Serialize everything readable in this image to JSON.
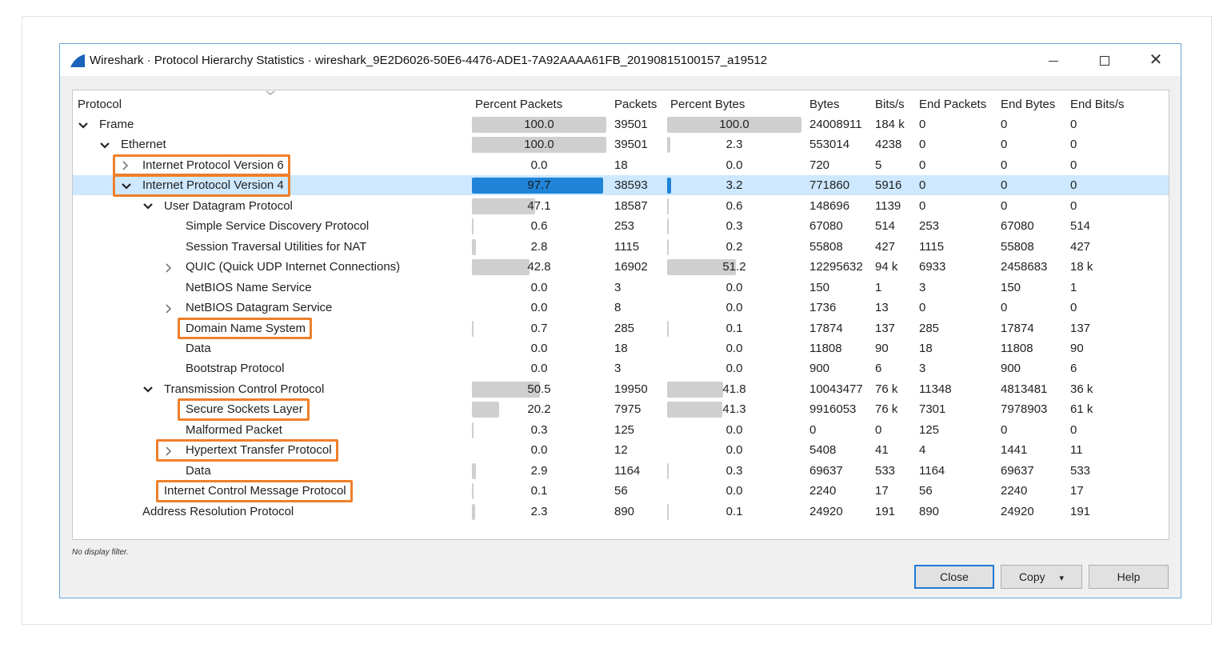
{
  "window": {
    "title": "Wireshark · Protocol Hierarchy Statistics · wireshark_9E2D6026-50E6-4476-ADE1-7A92AAAA61FB_20190815100157_a19512",
    "minimize_icon": "minimize-icon",
    "maximize_icon": "maximize-icon",
    "close_glyph": "✕"
  },
  "columns": [
    "Protocol",
    "Percent Packets",
    "Packets",
    "Percent Bytes",
    "Bytes",
    "Bits/s",
    "End Packets",
    "End Bytes",
    "End Bits/s"
  ],
  "rows": [
    {
      "name": "Frame",
      "level": 0,
      "expand": "open",
      "pct_packets": "100.0",
      "pct_packets_v": 100.0,
      "packets": "39501",
      "pct_bytes": "100.0",
      "pct_bytes_v": 100.0,
      "bytes": "24008911",
      "bits": "184 k",
      "end_packets": "0",
      "end_bytes": "0",
      "end_bits": "0"
    },
    {
      "name": "Ethernet",
      "level": 1,
      "expand": "open",
      "pct_packets": "100.0",
      "pct_packets_v": 100.0,
      "packets": "39501",
      "pct_bytes": "2.3",
      "pct_bytes_v": 2.3,
      "bytes": "553014",
      "bits": "4238",
      "end_packets": "0",
      "end_bytes": "0",
      "end_bits": "0"
    },
    {
      "name": "Internet Protocol Version 6",
      "level": 2,
      "expand": "closed",
      "pct_packets": "0.0",
      "pct_packets_v": 0.0,
      "packets": "18",
      "pct_bytes": "0.0",
      "pct_bytes_v": 0.0,
      "bytes": "720",
      "bits": "5",
      "end_packets": "0",
      "end_bytes": "0",
      "end_bits": "0"
    },
    {
      "name": "Internet Protocol Version 4",
      "level": 2,
      "expand": "open",
      "selected": true,
      "pct_packets": "97.7",
      "pct_packets_v": 97.7,
      "packets": "38593",
      "pct_bytes": "3.2",
      "pct_bytes_v": 3.2,
      "bytes": "771860",
      "bits": "5916",
      "end_packets": "0",
      "end_bytes": "0",
      "end_bits": "0"
    },
    {
      "name": "User Datagram Protocol",
      "level": 3,
      "expand": "open",
      "pct_packets": "47.1",
      "pct_packets_v": 47.1,
      "packets": "18587",
      "pct_bytes": "0.6",
      "pct_bytes_v": 0.6,
      "bytes": "148696",
      "bits": "1139",
      "end_packets": "0",
      "end_bytes": "0",
      "end_bits": "0"
    },
    {
      "name": "Simple Service Discovery Protocol",
      "level": 4,
      "expand": "none",
      "pct_packets": "0.6",
      "pct_packets_v": 0.6,
      "packets": "253",
      "pct_bytes": "0.3",
      "pct_bytes_v": 0.3,
      "bytes": "67080",
      "bits": "514",
      "end_packets": "253",
      "end_bytes": "67080",
      "end_bits": "514"
    },
    {
      "name": "Session Traversal Utilities for NAT",
      "level": 4,
      "expand": "none",
      "pct_packets": "2.8",
      "pct_packets_v": 2.8,
      "packets": "1115",
      "pct_bytes": "0.2",
      "pct_bytes_v": 0.2,
      "bytes": "55808",
      "bits": "427",
      "end_packets": "1115",
      "end_bytes": "55808",
      "end_bits": "427"
    },
    {
      "name": "QUIC (Quick UDP Internet Connections)",
      "level": 4,
      "expand": "closed",
      "pct_packets": "42.8",
      "pct_packets_v": 42.8,
      "packets": "16902",
      "pct_bytes": "51.2",
      "pct_bytes_v": 51.2,
      "bytes": "12295632",
      "bits": "94 k",
      "end_packets": "6933",
      "end_bytes": "2458683",
      "end_bits": "18 k"
    },
    {
      "name": "NetBIOS Name Service",
      "level": 4,
      "expand": "none",
      "pct_packets": "0.0",
      "pct_packets_v": 0.0,
      "packets": "3",
      "pct_bytes": "0.0",
      "pct_bytes_v": 0.0,
      "bytes": "150",
      "bits": "1",
      "end_packets": "3",
      "end_bytes": "150",
      "end_bits": "1"
    },
    {
      "name": "NetBIOS Datagram Service",
      "level": 4,
      "expand": "closed",
      "pct_packets": "0.0",
      "pct_packets_v": 0.0,
      "packets": "8",
      "pct_bytes": "0.0",
      "pct_bytes_v": 0.0,
      "bytes": "1736",
      "bits": "13",
      "end_packets": "0",
      "end_bytes": "0",
      "end_bits": "0"
    },
    {
      "name": "Domain Name System",
      "level": 4,
      "expand": "none",
      "pct_packets": "0.7",
      "pct_packets_v": 0.7,
      "packets": "285",
      "pct_bytes": "0.1",
      "pct_bytes_v": 0.1,
      "bytes": "17874",
      "bits": "137",
      "end_packets": "285",
      "end_bytes": "17874",
      "end_bits": "137"
    },
    {
      "name": "Data",
      "level": 4,
      "expand": "none",
      "pct_packets": "0.0",
      "pct_packets_v": 0.0,
      "packets": "18",
      "pct_bytes": "0.0",
      "pct_bytes_v": 0.0,
      "bytes": "11808",
      "bits": "90",
      "end_packets": "18",
      "end_bytes": "11808",
      "end_bits": "90"
    },
    {
      "name": "Bootstrap Protocol",
      "level": 4,
      "expand": "none",
      "pct_packets": "0.0",
      "pct_packets_v": 0.0,
      "packets": "3",
      "pct_bytes": "0.0",
      "pct_bytes_v": 0.0,
      "bytes": "900",
      "bits": "6",
      "end_packets": "3",
      "end_bytes": "900",
      "end_bits": "6"
    },
    {
      "name": "Transmission Control Protocol",
      "level": 3,
      "expand": "open",
      "pct_packets": "50.5",
      "pct_packets_v": 50.5,
      "packets": "19950",
      "pct_bytes": "41.8",
      "pct_bytes_v": 41.8,
      "bytes": "10043477",
      "bits": "76 k",
      "end_packets": "11348",
      "end_bytes": "4813481",
      "end_bits": "36 k"
    },
    {
      "name": "Secure Sockets Layer",
      "level": 4,
      "expand": "none",
      "pct_packets": "20.2",
      "pct_packets_v": 20.2,
      "packets": "7975",
      "pct_bytes": "41.3",
      "pct_bytes_v": 41.3,
      "bytes": "9916053",
      "bits": "76 k",
      "end_packets": "7301",
      "end_bytes": "7978903",
      "end_bits": "61 k"
    },
    {
      "name": "Malformed Packet",
      "level": 4,
      "expand": "none",
      "pct_packets": "0.3",
      "pct_packets_v": 0.3,
      "packets": "125",
      "pct_bytes": "0.0",
      "pct_bytes_v": 0.0,
      "bytes": "0",
      "bits": "0",
      "end_packets": "125",
      "end_bytes": "0",
      "end_bits": "0"
    },
    {
      "name": "Hypertext Transfer Protocol",
      "level": 4,
      "expand": "closed",
      "pct_packets": "0.0",
      "pct_packets_v": 0.0,
      "packets": "12",
      "pct_bytes": "0.0",
      "pct_bytes_v": 0.0,
      "bytes": "5408",
      "bits": "41",
      "end_packets": "4",
      "end_bytes": "1441",
      "end_bits": "11"
    },
    {
      "name": "Data",
      "level": 4,
      "expand": "none",
      "pct_packets": "2.9",
      "pct_packets_v": 2.9,
      "packets": "1164",
      "pct_bytes": "0.3",
      "pct_bytes_v": 0.3,
      "bytes": "69637",
      "bits": "533",
      "end_packets": "1164",
      "end_bytes": "69637",
      "end_bits": "533"
    },
    {
      "name": "Internet Control Message Protocol",
      "level": 3,
      "expand": "none",
      "pct_packets": "0.1",
      "pct_packets_v": 0.1,
      "packets": "56",
      "pct_bytes": "0.0",
      "pct_bytes_v": 0.0,
      "bytes": "2240",
      "bits": "17",
      "end_packets": "56",
      "end_bytes": "2240",
      "end_bits": "17"
    },
    {
      "name": "Address Resolution Protocol",
      "level": 2,
      "expand": "none",
      "pct_packets": "2.3",
      "pct_packets_v": 2.3,
      "packets": "890",
      "pct_bytes": "0.1",
      "pct_bytes_v": 0.1,
      "bytes": "24920",
      "bits": "191",
      "end_packets": "890",
      "end_bytes": "24920",
      "end_bits": "191"
    }
  ],
  "highlighted_rows": [
    2,
    3,
    10,
    14,
    16,
    18
  ],
  "highlight_color": "#ef7f2a",
  "selection_color": "#cde8ff",
  "status": "No display filter.",
  "buttons": {
    "close": "Close",
    "copy": "Copy",
    "copy_dropdown": "▾",
    "help": "Help"
  }
}
